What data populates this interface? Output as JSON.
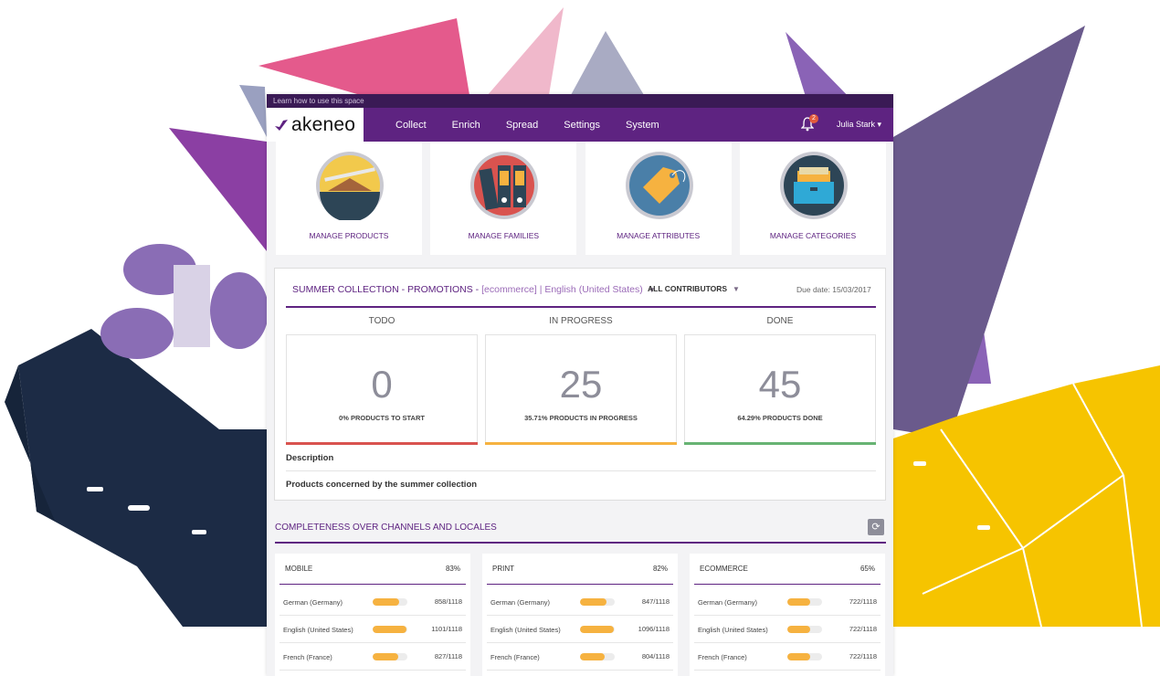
{
  "help_bar": {
    "text": "Learn how to use this space"
  },
  "nav": {
    "logo_text": "akeneo",
    "items": [
      "Collect",
      "Enrich",
      "Spread",
      "Settings",
      "System"
    ],
    "notification_count": "2",
    "user_name": "Julia Stark ▾"
  },
  "tiles": [
    {
      "label": "MANAGE PRODUCTS",
      "icon": "hanger-icon"
    },
    {
      "label": "MANAGE FAMILIES",
      "icon": "binders-icon"
    },
    {
      "label": "MANAGE ATTRIBUTES",
      "icon": "tag-icon"
    },
    {
      "label": "MANAGE CATEGORIES",
      "icon": "drawer-icon"
    }
  ],
  "project": {
    "name": "SUMMER COLLECTION - PROMOTIONS - ",
    "scope": "[ecommerce] | English (United States)",
    "contributors": "ALL CONTRIBUTORS",
    "due_date": "Due date: 15/03/2017",
    "columns": [
      {
        "header": "TODO",
        "count": "0",
        "caption": "0% PRODUCTS TO START",
        "color": "#d9534f"
      },
      {
        "header": "IN PROGRESS",
        "count": "25",
        "caption": "35.71% PRODUCTS IN PROGRESS",
        "color": "#f6b240"
      },
      {
        "header": "DONE",
        "count": "45",
        "caption": "64.29% PRODUCTS DONE",
        "color": "#67b373"
      }
    ],
    "description_label": "Description",
    "description": "Products concerned by the summer collection"
  },
  "completeness": {
    "title": "COMPLETENESS OVER CHANNELS AND LOCALES",
    "channels": [
      {
        "name": "MOBILE",
        "percent": "83%",
        "locales": [
          {
            "name": "German (Germany)",
            "count": "858/1118",
            "ratio": 0.767
          },
          {
            "name": "English (United States)",
            "count": "1101/1118",
            "ratio": 0.985
          },
          {
            "name": "French (France)",
            "count": "827/1118",
            "ratio": 0.74
          }
        ]
      },
      {
        "name": "PRINT",
        "percent": "82%",
        "locales": [
          {
            "name": "German (Germany)",
            "count": "847/1118",
            "ratio": 0.758
          },
          {
            "name": "English (United States)",
            "count": "1096/1118",
            "ratio": 0.98
          },
          {
            "name": "French (France)",
            "count": "804/1118",
            "ratio": 0.719
          }
        ]
      },
      {
        "name": "ECOMMERCE",
        "percent": "65%",
        "locales": [
          {
            "name": "German (Germany)",
            "count": "722/1118",
            "ratio": 0.646
          },
          {
            "name": "English (United States)",
            "count": "722/1118",
            "ratio": 0.646
          },
          {
            "name": "French (France)",
            "count": "722/1118",
            "ratio": 0.646
          }
        ]
      }
    ]
  },
  "colors": {
    "brand_purple": "#5e2381",
    "accent_yellow": "#f6b240"
  }
}
